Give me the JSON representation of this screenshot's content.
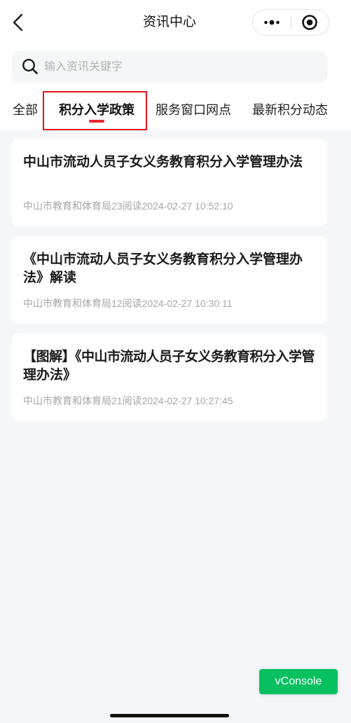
{
  "colors": {
    "page_bg": "#f4f6fa",
    "accent": "#e5262e",
    "annotation": "#e0161e",
    "vconsole": "#07c160"
  },
  "nav": {
    "title": "资讯中心",
    "back_icon": "chevron-left-icon",
    "more_icon": "more-dots-icon",
    "close_icon": "target-icon"
  },
  "search": {
    "icon": "search-icon",
    "placeholder": "输入资讯关键字",
    "value": ""
  },
  "tabs": [
    {
      "label": "全部",
      "selected": false
    },
    {
      "label": "积分入学政策",
      "selected": true
    },
    {
      "label": "服务窗口网点",
      "selected": false
    },
    {
      "label": "最新积分动态",
      "selected": false
    }
  ],
  "reads_suffix": "阅读",
  "articles": [
    {
      "title_lines": [
        "中山市流动人员子女义务教育积分入学管理办法"
      ],
      "source": "中山市教育和体育局",
      "reads": 23,
      "time": "2024-02-27 10:52:10"
    },
    {
      "title_lines": [
        "《中山市流动人员子女义务教育积分入学管理办",
        "法》解读"
      ],
      "source": "中山市教育和体育局",
      "reads": 12,
      "time": "2024-02-27 10:30:11"
    },
    {
      "title_lines": [
        "【图解】《中山市流动人员子女义务教育积分入学管",
        "理办法》"
      ],
      "source": "中山市教育和体育局",
      "reads": 21,
      "time": "2024-02-27 10:27:45"
    }
  ],
  "vconsole": {
    "label": "vConsole"
  }
}
